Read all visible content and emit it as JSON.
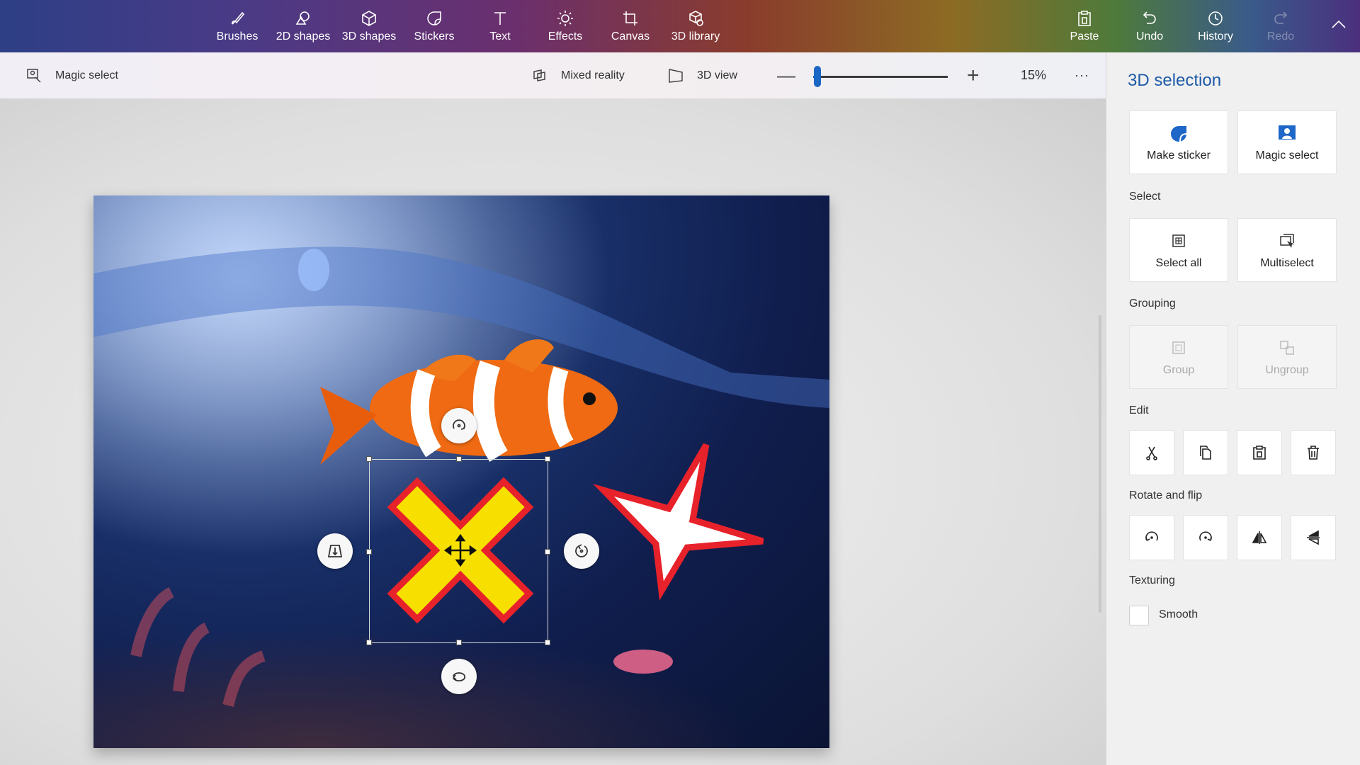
{
  "toolbar": {
    "items": [
      {
        "label": "Brushes",
        "icon": "brush-icon"
      },
      {
        "label": "2D shapes",
        "icon": "2d-shapes-icon"
      },
      {
        "label": "3D shapes",
        "icon": "3d-shapes-icon"
      },
      {
        "label": "Stickers",
        "icon": "sticker-icon"
      },
      {
        "label": "Text",
        "icon": "text-icon"
      },
      {
        "label": "Effects",
        "icon": "effects-icon"
      },
      {
        "label": "Canvas",
        "icon": "canvas-icon"
      },
      {
        "label": "3D library",
        "icon": "3d-library-icon"
      }
    ],
    "right": [
      {
        "label": "Paste",
        "icon": "paste-icon"
      },
      {
        "label": "Undo",
        "icon": "undo-icon"
      },
      {
        "label": "History",
        "icon": "history-icon"
      },
      {
        "label": "Redo",
        "icon": "redo-icon"
      }
    ]
  },
  "subbar": {
    "magic_select": "Magic select",
    "mixed_reality": "Mixed reality",
    "view_3d": "3D view",
    "zoom_label": "15%",
    "zoom_value": 0.03,
    "more": "···"
  },
  "panel": {
    "title": "3D selection",
    "make_sticker": "Make sticker",
    "magic_select": "Magic select",
    "select_label": "Select",
    "select_all": "Select all",
    "multiselect": "Multiselect",
    "grouping_label": "Grouping",
    "group": "Group",
    "ungroup": "Ungroup",
    "edit_label": "Edit",
    "rotate_label": "Rotate and flip",
    "texturing_label": "Texturing",
    "smooth": "Smooth",
    "smooth_checked": false
  },
  "colors": {
    "accent": "#1d5aa8",
    "x_fill": "#f7e000",
    "x_stroke": "#e8222a",
    "star_fill": "#ffffff",
    "star_stroke": "#e8222a"
  }
}
